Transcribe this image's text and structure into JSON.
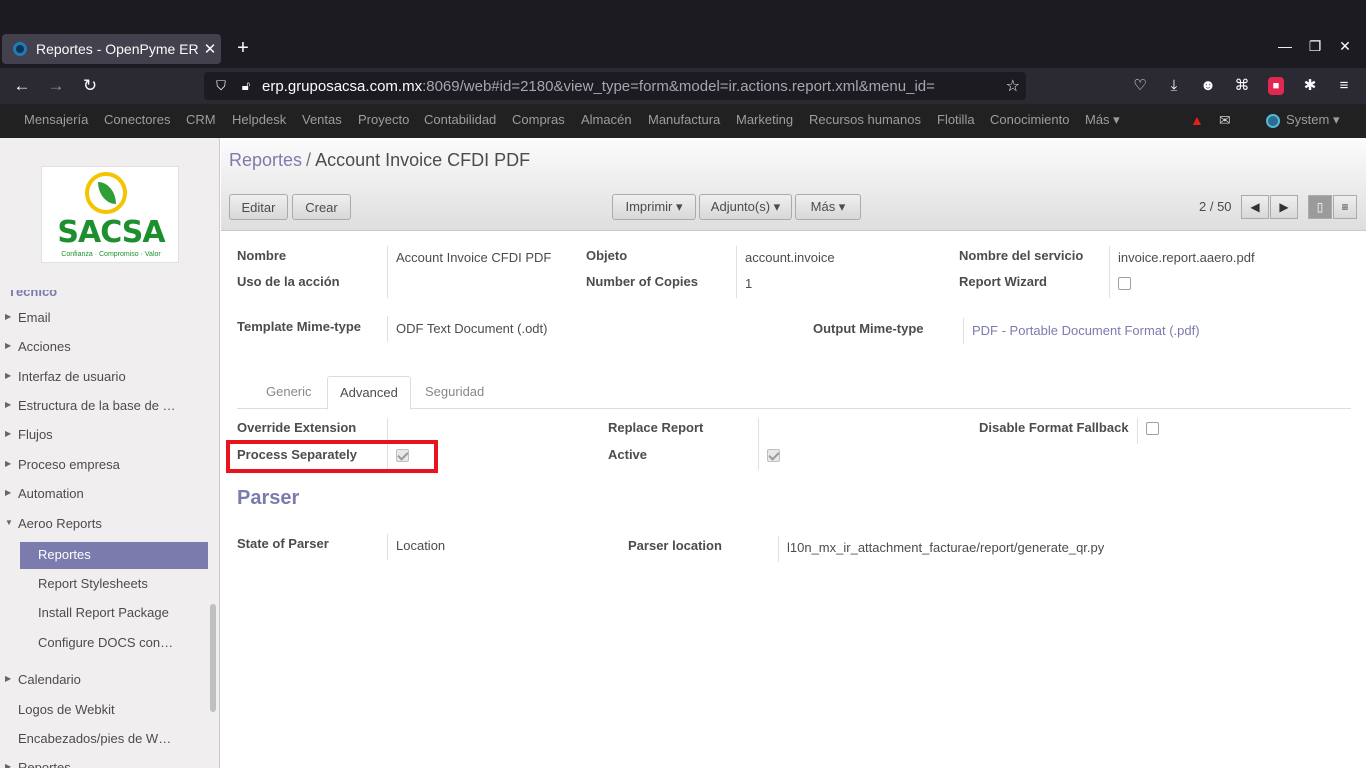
{
  "browser": {
    "tab_title": "Reportes - OpenPyme ERP",
    "tab_close": "✕",
    "new_tab": "+",
    "url_host": "erp.gruposacsa.com.mx",
    "url_rest": ":8069/web#id=2180&view_type=form&model=ir.actions.report.xml&menu_id="
  },
  "topmenu": {
    "items": [
      "Mensajería",
      "Conectores",
      "CRM",
      "Helpdesk",
      "Ventas",
      "Proyecto",
      "Contabilidad",
      "Compras",
      "Almacén",
      "Manufactura",
      "Marketing",
      "Recursos humanos",
      "Flotilla",
      "Conocimiento",
      "Más ▾"
    ],
    "user": "System ▾"
  },
  "logo": {
    "brand": "SACSA",
    "tagline": "Confianza · Compromiso · Valor"
  },
  "sidebar": {
    "cut_label": "Técnico",
    "items": [
      {
        "label": "Email",
        "caret": true,
        "level": 0
      },
      {
        "label": "Acciones",
        "caret": true,
        "level": 0
      },
      {
        "label": "Interfaz de usuario",
        "caret": true,
        "level": 0
      },
      {
        "label": "Estructura de la base de …",
        "caret": true,
        "level": 0
      },
      {
        "label": "Flujos",
        "caret": true,
        "level": 0
      },
      {
        "label": "Proceso empresa",
        "caret": true,
        "level": 0
      },
      {
        "label": "Automation",
        "caret": true,
        "level": 0
      },
      {
        "label": "Aeroo Reports",
        "caret": true,
        "open": true,
        "level": 0
      },
      {
        "label": "Reportes",
        "level": 1,
        "active": true
      },
      {
        "label": "Report Stylesheets",
        "level": 1
      },
      {
        "label": "Install Report Package",
        "level": 1
      },
      {
        "label": "Configure DOCS con…",
        "level": 1
      },
      {
        "label": "Calendario",
        "caret": true,
        "level": 0
      },
      {
        "label": "Logos de Webkit",
        "level": 0
      },
      {
        "label": "Encabezados/pies de W…",
        "level": 0
      },
      {
        "label": "Reportes",
        "caret": true,
        "level": 0
      }
    ]
  },
  "breadcrumb": {
    "parent": "Reportes",
    "sep": "/",
    "current": "Account Invoice CFDI PDF"
  },
  "buttons": {
    "edit": "Editar",
    "create": "Crear",
    "print": "Imprimir ▾",
    "attach": "Adjunto(s) ▾",
    "more": "Más ▾"
  },
  "pager": {
    "text": "2 / 50"
  },
  "form": {
    "nombre_label": "Nombre",
    "nombre_value": "Account Invoice CFDI PDF",
    "uso_label": "Uso de la acción",
    "objeto_label": "Objeto",
    "objeto_value": "account.invoice",
    "copies_label": "Number of Copies",
    "copies_value": "1",
    "servicio_label": "Nombre del servicio",
    "servicio_value": "invoice.report.aaero.pdf",
    "wizard_label": "Report Wizard",
    "template_label": "Template Mime-type",
    "template_value": "ODF Text Document (.odt)",
    "output_label": "Output Mime-type",
    "output_value": "PDF - Portable Document Format (.pdf)"
  },
  "tabs": [
    "Generic",
    "Advanced",
    "Seguridad"
  ],
  "advanced": {
    "override_label": "Override Extension",
    "process_label": "Process Separately",
    "replace_label": "Replace Report",
    "active_label": "Active",
    "fallback_label": "Disable Format Fallback"
  },
  "parser": {
    "title": "Parser",
    "state_label": "State of Parser",
    "state_value": "Location",
    "location_label": "Parser location",
    "location_value": "l10n_mx_ir_attachment_facturae/report/generate_qr.py"
  }
}
